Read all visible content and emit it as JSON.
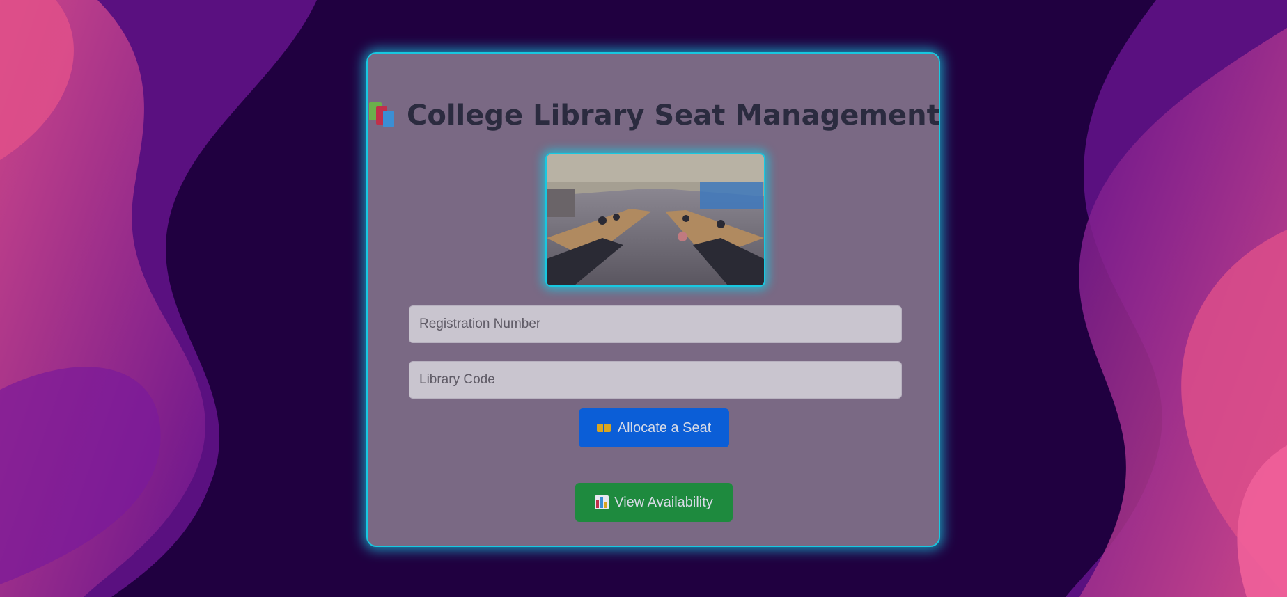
{
  "page": {
    "title_icon": "books-icon",
    "title": "College Library Seat Management"
  },
  "hero_image": {
    "alt": "Library reading hall with students seated at long tables"
  },
  "form": {
    "registration_placeholder": "Registration Number",
    "library_code_placeholder": "Library Code"
  },
  "actions": {
    "allocate_icon": "ticket-icon",
    "allocate_label": "Allocate a Seat",
    "view_icon": "bar-chart-icon",
    "view_label": "View Availability"
  },
  "colors": {
    "background": "#200040",
    "accent_glow": "#18c8e0",
    "allocate_button": "#0b5ed7",
    "view_button": "#1e8a3e"
  }
}
